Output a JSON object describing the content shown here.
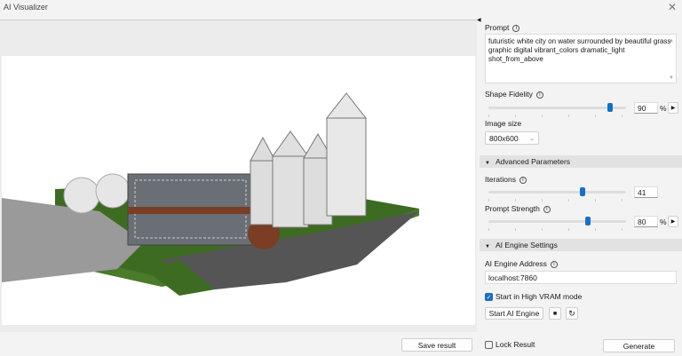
{
  "window": {
    "title": "AI Visualizer",
    "close_icon": "close-icon"
  },
  "viewer": {
    "save_label": "Save result"
  },
  "panel": {
    "prompt": {
      "label": "Prompt",
      "value": "futuristic white city on water surrounded by beautiful grass graphic digital vibrant_colors dramatic_light shot_from_above"
    },
    "shape_fidelity": {
      "label": "Shape Fidelity",
      "value": "90",
      "unit": "%",
      "level": 90
    },
    "image_size": {
      "label": "Image size",
      "value": "800x600"
    },
    "advanced": {
      "label": "Advanced Parameters",
      "iterations": {
        "label": "Iterations",
        "value": "41",
        "level": 0.6
      },
      "prompt_strength": {
        "label": "Prompt Strength",
        "value": "80",
        "unit": "%",
        "level": 0.62
      }
    },
    "engine": {
      "label": "AI Engine Settings",
      "address_label": "AI Engine Address",
      "address": "localhost:7860",
      "high_vram_label": "Start in High VRAM mode",
      "high_vram": true,
      "start_label": "Start AI Engine"
    },
    "lock_label": "Lock Result",
    "generate_label": "Generate"
  },
  "colors": {
    "accent": "#1a6fc2"
  }
}
